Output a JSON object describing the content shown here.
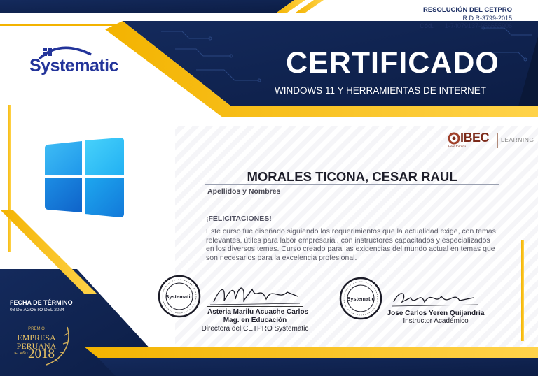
{
  "header": {
    "resolution_title": "RESOLUCIÓN DEL CETPRO",
    "resolution_number": "R.D.R-3799-2015",
    "code_label": "Cód.",
    "code_value": "1-74079137-956655906"
  },
  "brand": {
    "logo_text": "Systematic"
  },
  "certificate": {
    "title": "CERTIFICADO",
    "course": "WINDOWS 11 Y HERRAMIENTAS DE INTERNET"
  },
  "partner": {
    "name": "IBEC",
    "tagline": "Here for You",
    "suffix": "LEARNING"
  },
  "recipient": {
    "name": "MORALES TICONA, CESAR RAUL",
    "caption": "Apellidos y Nombres"
  },
  "body": {
    "congrats": "¡FELICITACIONES!",
    "description": "Este curso fue diseñado siguiendo los requerimientos que la actualidad exige, con temas relevantes, útiles para labor empresarial, con instructores capacitados y especializados en los diversos temas. Curso creado para las exigencias del mundo actual en temas que son necesarios para la excelencia profesional."
  },
  "signatures": [
    {
      "name": "Asteria Marilu Acuache Carlos",
      "degree": "Mag. en Educación",
      "role": "Directora del CETPRO Systematic",
      "stamp_label": "Systematic"
    },
    {
      "name": "Jose Carlos Yeren Quijandria",
      "role": "Instructor Académico",
      "stamp_label": "Systematic"
    }
  ],
  "completion": {
    "label": "FECHA DE TÉRMINO",
    "date": "08 DE AGOSTO DEL 2024"
  },
  "award": {
    "line1": "PREMIO",
    "line2": "EMPRESA",
    "line3": "PERUANA",
    "line4": "DEL AÑO",
    "year": "2018"
  },
  "colors": {
    "navy": "#0f2350",
    "gold": "#f5b800",
    "brand_blue": "#23349a",
    "windows_blue": "#1a8fe0"
  },
  "icons": [
    "windows-logo-icon",
    "systematic-logo-icon",
    "ibec-logo-icon",
    "stamp-icon",
    "signature-icon",
    "laurel-icon"
  ]
}
